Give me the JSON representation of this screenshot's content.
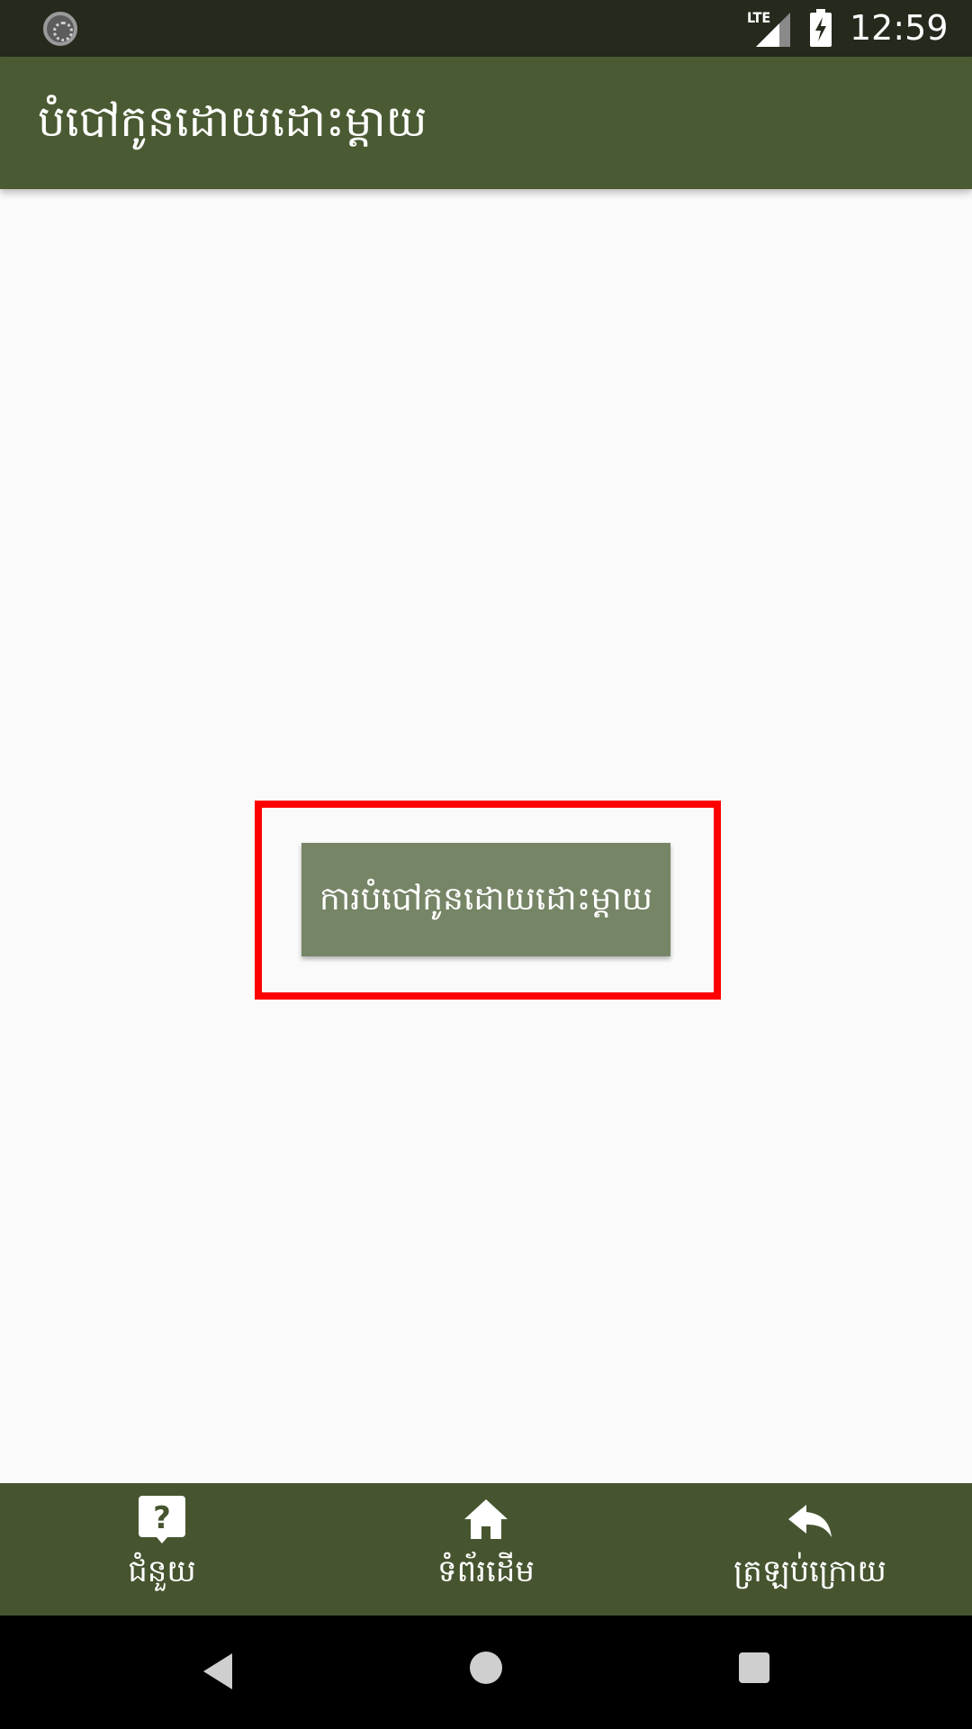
{
  "status_bar": {
    "network_label": "LTE",
    "time": "12:59",
    "icons": [
      "sync-icon",
      "lte-signal-icon",
      "battery-charging-icon"
    ]
  },
  "app_bar": {
    "title": "បំបៅកូនដោយដោះម្ដាយ"
  },
  "main": {
    "button_label": "ការបំបៅកូនដោយដោះម្ដាយ",
    "highlight_color": "#ff0000"
  },
  "bottom_nav": {
    "items": [
      {
        "label": "ជំនួយ",
        "icon": "help-icon"
      },
      {
        "label": "ទំព័រដើម",
        "icon": "home-icon"
      },
      {
        "label": "ត្រឡប់ក្រោយ",
        "icon": "reply-back-icon"
      }
    ]
  },
  "system_nav": {
    "icons": [
      "back-icon",
      "home-circle-icon",
      "recents-icon"
    ]
  },
  "colors": {
    "app_bar": "#4a5a32",
    "bottom_nav": "#46552f",
    "button": "#768566",
    "status_bar": "#252a1d",
    "background": "#fafafa"
  }
}
